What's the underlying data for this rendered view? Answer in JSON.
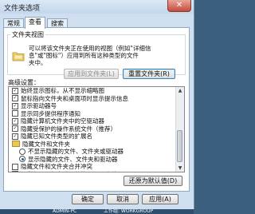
{
  "window": {
    "title": "文件夹选项",
    "close_glyph": "✕"
  },
  "tabs": [
    {
      "label": "常规",
      "active": false
    },
    {
      "label": "查看",
      "active": true
    },
    {
      "label": "搜索",
      "active": false
    }
  ],
  "folder_views": {
    "group_label": "文件夹视图",
    "description": [
      "可以将该文件夹正在使用的视图（例如\"详细信",
      "息\"或\"图标\"）应用到所有这种类型的文件",
      "夹中。"
    ],
    "apply_button": "应用到文件夹(L)",
    "reset_button": "重置文件夹(R)"
  },
  "advanced": {
    "label": "高级设置：",
    "items": [
      {
        "type": "checkbox",
        "checked": true,
        "indent": 1,
        "text": "始终显示图标，从不显示缩略图"
      },
      {
        "type": "checkbox",
        "checked": true,
        "indent": 1,
        "text": "鼠标指向文件夹和桌面项时显示提示信息"
      },
      {
        "type": "checkbox",
        "checked": true,
        "indent": 1,
        "text": "显示驱动器号"
      },
      {
        "type": "checkbox",
        "checked": false,
        "indent": 1,
        "text": "显示同步提供程序通知"
      },
      {
        "type": "checkbox",
        "checked": true,
        "indent": 1,
        "text": "隐藏计算机文件夹中的空驱动器"
      },
      {
        "type": "checkbox",
        "checked": true,
        "indent": 1,
        "text": "隐藏受保护的操作系统文件（推荐）"
      },
      {
        "type": "checkbox",
        "checked": true,
        "indent": 1,
        "text": "隐藏已知文件类型的扩展名"
      },
      {
        "type": "folder",
        "indent": 1,
        "text": "隐藏文件和文件夹"
      },
      {
        "type": "radio",
        "on": false,
        "indent": 2,
        "text": "不显示隐藏的文件、文件夹或驱动器"
      },
      {
        "type": "radio",
        "on": true,
        "indent": 2,
        "text": "显示隐藏的文件、文件夹和驱动器"
      },
      {
        "type": "checkbox",
        "checked": false,
        "indent": 1,
        "text": "隐藏文件和文件夹合并冲突"
      },
      {
        "type": "checkbox",
        "checked": true,
        "indent": 1,
        "text": "用彩色显示加密或压缩的 NTFS 文件"
      },
      {
        "type": "checkbox",
        "checked": true,
        "indent": 1,
        "text": "在标题栏显示完整路径（仅限经典主题）"
      },
      {
        "type": "checkbox",
        "checked": false,
        "indent": 1,
        "text": "在单独的进程中打开文件夹窗口"
      }
    ]
  },
  "scrollbar": {
    "up": "▲",
    "down": "▼"
  },
  "buttons": {
    "restore_defaults": "还原为默认值(D)",
    "ok": "确定",
    "cancel": "取消",
    "apply": "应用(A)"
  },
  "statusbar": {
    "user": "ADMIN-PC",
    "workgroup": "工作组: WORKGROUP"
  }
}
